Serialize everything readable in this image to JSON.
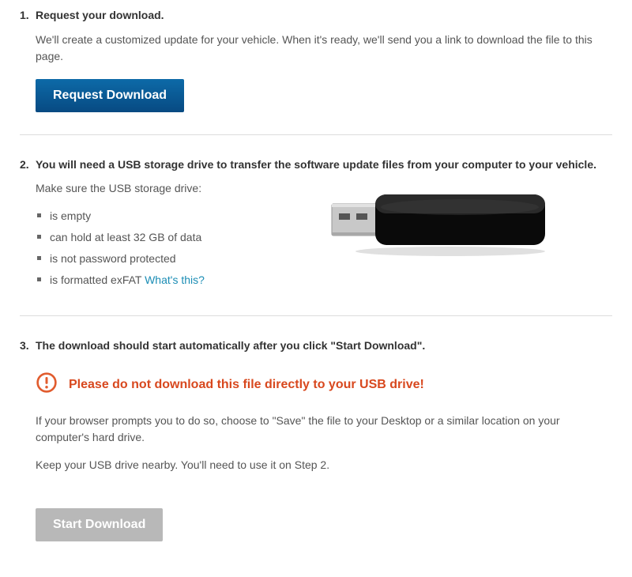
{
  "step1": {
    "number": "1.",
    "title": "Request your download.",
    "desc": "We'll create a customized update for your vehicle. When it's ready, we'll send you a link to download the file to this page.",
    "button": "Request Download"
  },
  "step2": {
    "number": "2.",
    "title": "You will need a USB storage drive to transfer the software update files from your computer to your vehicle.",
    "intro": "Make sure the USB storage drive:",
    "req1": "is empty",
    "req2": "can hold at least 32 GB of data",
    "req3": "is not password protected",
    "req4": "is formatted exFAT ",
    "link": "What's this?"
  },
  "step3": {
    "number": "3.",
    "title": "The download should start automatically after you click \"Start Download\".",
    "warning": "Please do not download this file directly to your USB drive!",
    "p1": "If your browser prompts you to do so, choose to \"Save\" the file to your Desktop or a similar location on your computer's hard drive.",
    "p2": "Keep your USB drive nearby. You'll need to use it on Step 2.",
    "button": "Start Download"
  }
}
